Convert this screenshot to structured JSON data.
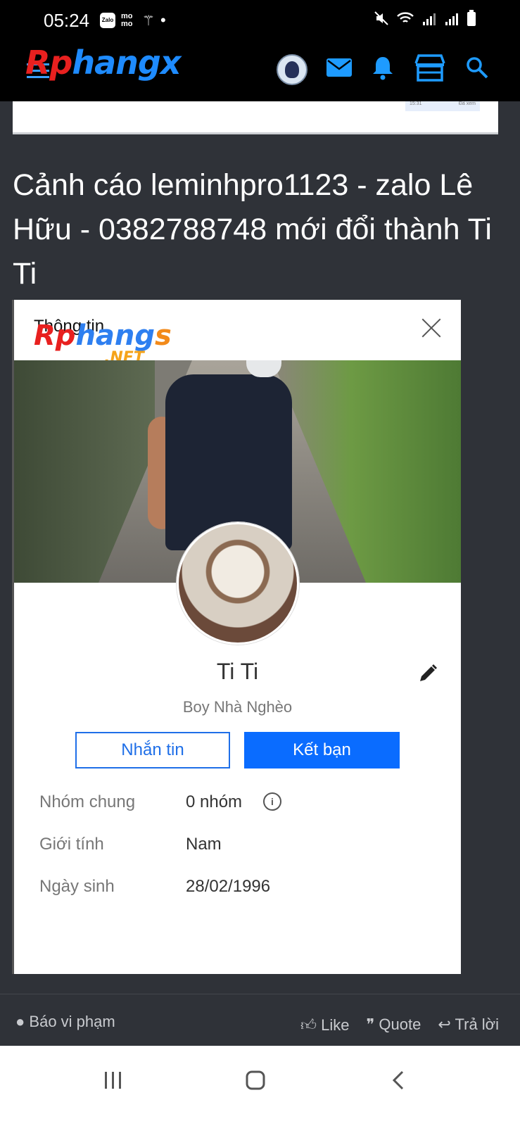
{
  "status_bar": {
    "time": "05:24",
    "zalo_label": "Zalo",
    "momo_label": "mo mo"
  },
  "site": {
    "logo_text": {
      "part1": "Rp",
      "part2": "hangx",
      "part3": ""
    },
    "header_icons": [
      "avatar",
      "mail-icon",
      "bell-icon",
      "store-icon",
      "search-icon"
    ],
    "accent_color": "#1e9bff"
  },
  "previous_card": {
    "time": "15:31",
    "seen": "Đã xem"
  },
  "thread": {
    "title": "Cảnh cáo leminhpro1123 - zalo Lê Hữu - 0382788748 mới đổi thành Ti Ti"
  },
  "profile_dialog": {
    "title": "Thông tin",
    "watermark": {
      "part1": "Rp",
      "part2": "hang",
      "part3": "s",
      "net": ".NET"
    },
    "name": "Ti Ti",
    "status": "Boy Nhà Nghèo",
    "message_button": "Nhắn tin",
    "add_friend_button": "Kết bạn",
    "info": [
      {
        "label": "Nhóm chung",
        "value": "0 nhóm"
      },
      {
        "label": "Giới tính",
        "value": "Nam"
      },
      {
        "label": "Ngày sinh",
        "value": "28/02/1996"
      }
    ]
  },
  "post_actions": {
    "report": "Báo vi phạm",
    "like": "Like",
    "quote": "Quote",
    "reply": "Trả lời"
  }
}
